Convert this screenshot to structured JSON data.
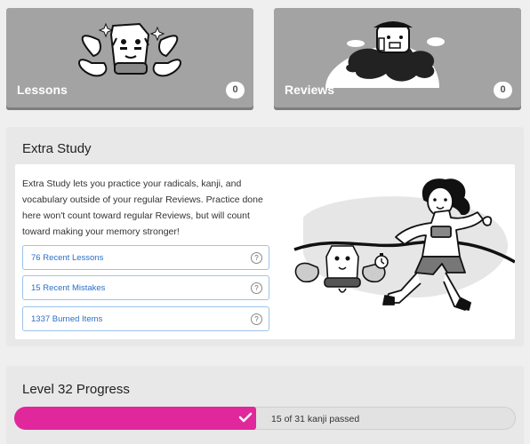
{
  "tiles": {
    "lessons": {
      "label": "Lessons",
      "count": "0"
    },
    "reviews": {
      "label": "Reviews",
      "count": "0"
    }
  },
  "extra_study": {
    "title": "Extra Study",
    "description": "Extra Study lets you practice your radicals, kanji, and vocabulary outside of your regular Reviews. Practice done here won't count toward regular Reviews, but will count toward making your memory stronger!",
    "buttons": [
      {
        "label": "76 Recent Lessons",
        "help": "?"
      },
      {
        "label": "15 Recent Mistakes",
        "help": "?"
      },
      {
        "label": "1337 Burned Items",
        "help": "?"
      }
    ]
  },
  "level_progress": {
    "title": "Level 32 Progress",
    "label": "15 of 31 kanji passed",
    "passed": 15,
    "total": 31,
    "fraction": 0.484,
    "color": "#e0279c"
  },
  "icons": [
    "crab-mascot-icon",
    "sparkle-icon",
    "cloud-mascot-icon",
    "runner-illustration-icon",
    "stopwatch-icon",
    "help-icon",
    "checkmark-icon"
  ]
}
